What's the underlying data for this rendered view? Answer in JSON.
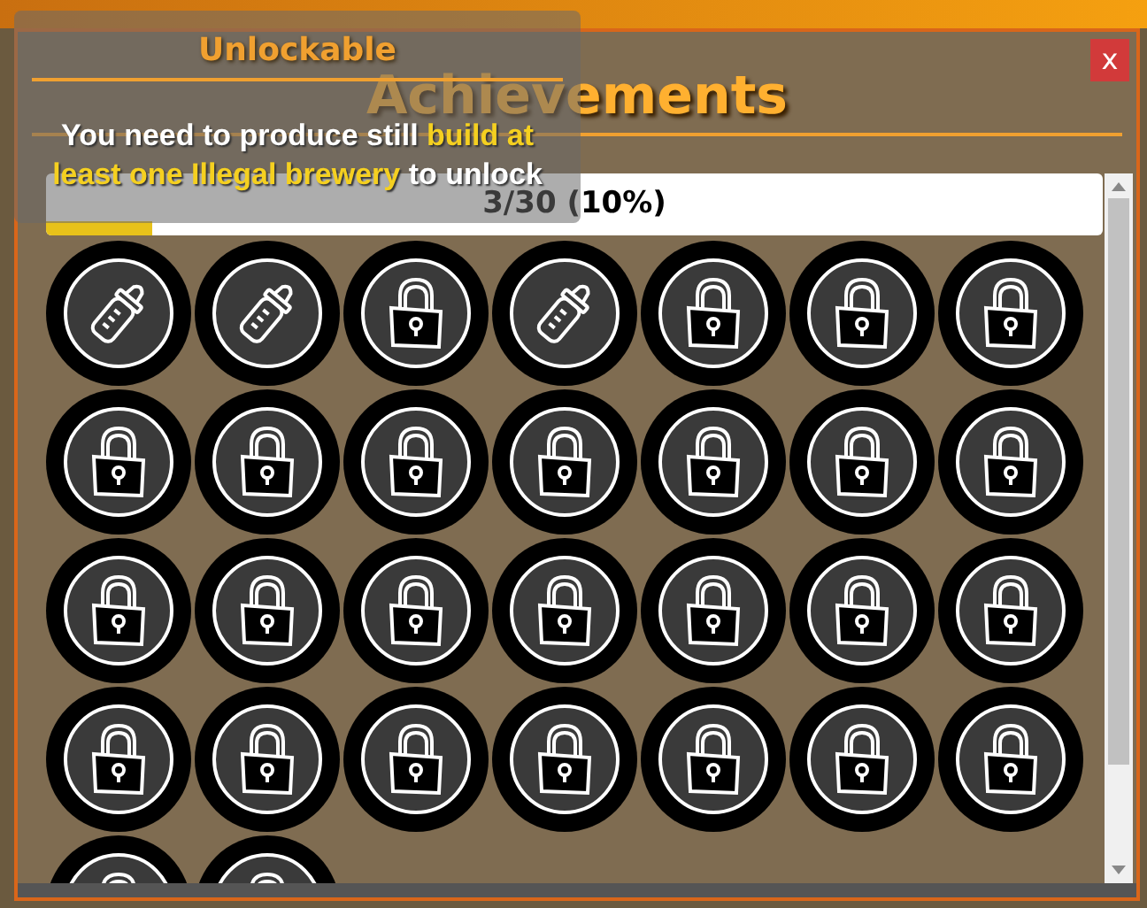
{
  "dialog": {
    "title": "Achievements",
    "close": "x"
  },
  "progress": {
    "text": "3/30 (10%)",
    "level": 0.1
  },
  "achievements": [
    {
      "unlocked": true
    },
    {
      "unlocked": true
    },
    {
      "unlocked": false
    },
    {
      "unlocked": true
    },
    {
      "unlocked": false
    },
    {
      "unlocked": false
    },
    {
      "unlocked": false
    },
    {
      "unlocked": false
    },
    {
      "unlocked": false
    },
    {
      "unlocked": false
    },
    {
      "unlocked": false
    },
    {
      "unlocked": false
    },
    {
      "unlocked": false
    },
    {
      "unlocked": false
    },
    {
      "unlocked": false
    },
    {
      "unlocked": false
    },
    {
      "unlocked": false
    },
    {
      "unlocked": false
    },
    {
      "unlocked": false
    },
    {
      "unlocked": false
    },
    {
      "unlocked": false
    },
    {
      "unlocked": false
    },
    {
      "unlocked": false
    },
    {
      "unlocked": false
    },
    {
      "unlocked": false
    },
    {
      "unlocked": false
    },
    {
      "unlocked": false
    },
    {
      "unlocked": false
    },
    {
      "unlocked": false
    },
    {
      "unlocked": false
    }
  ],
  "tooltip": {
    "title": "Unlockable",
    "text_before": "You need to produce still",
    "highlight": "build at least one Illegal brewery",
    "text_after": "to unlock"
  }
}
